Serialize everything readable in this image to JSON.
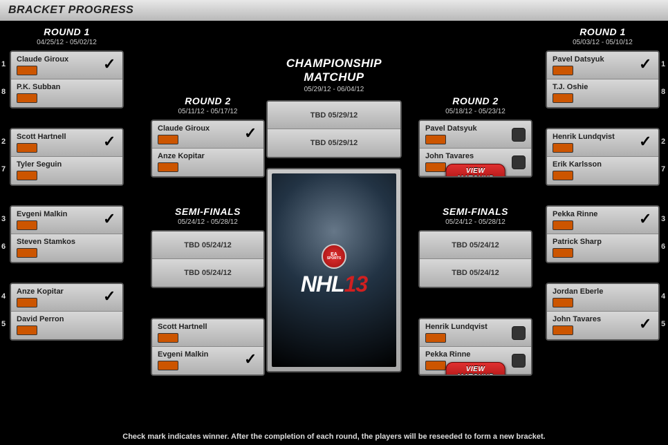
{
  "header": {
    "title": "BRACKET PROGRESS"
  },
  "footer": "Check mark indicates winner. After the completion of each round, the players will be reseeded to form a new bracket.",
  "view_matchup": "VIEW MATCHUP",
  "championship": {
    "title": "CHAMPIONSHIP MATCHUP",
    "dates": "05/29/12 - 06/04/12",
    "slot1": "TBD 05/29/12",
    "slot2": "TBD 05/29/12"
  },
  "game": {
    "brand": "EA",
    "sub": "SPORTS",
    "title_a": "NHL",
    "title_b": "13"
  },
  "left": {
    "r1": {
      "title": "ROUND 1",
      "dates": "04/25/12 - 05/02/12",
      "m": [
        {
          "s1": "1",
          "s2": "8",
          "p1": "Claude Giroux",
          "p2": "P.K. Subban",
          "w": 1,
          "l1": "lg-phi",
          "l2": "lg-mtl"
        },
        {
          "s1": "2",
          "s2": "7",
          "p1": "Scott Hartnell",
          "p2": "Tyler Seguin",
          "w": 1,
          "l1": "lg-phi",
          "l2": "lg-bos"
        },
        {
          "s1": "3",
          "s2": "6",
          "p1": "Evgeni Malkin",
          "p2": "Steven Stamkos",
          "w": 1,
          "l1": "lg-pit",
          "l2": "lg-tb"
        },
        {
          "s1": "4",
          "s2": "5",
          "p1": "Anze Kopitar",
          "p2": "David Perron",
          "w": 1,
          "l1": "lg-la",
          "l2": "lg-stl"
        }
      ]
    },
    "r2": {
      "title": "ROUND 2",
      "dates": "05/11/12 - 05/17/12",
      "m": [
        {
          "p1": "Claude Giroux",
          "p2": "Anze Kopitar",
          "w": 1,
          "l1": "lg-phi",
          "l2": "lg-la"
        },
        {
          "p1": "Scott Hartnell",
          "p2": "Evgeni Malkin",
          "w": 0,
          "l1": "lg-phi",
          "l2": "lg-pit"
        }
      ]
    },
    "sf": {
      "title": "SEMI-FINALS",
      "dates": "05/24/12 - 05/28/12",
      "s1": "TBD 05/24/12",
      "s2": "TBD 05/24/12"
    }
  },
  "right": {
    "r1": {
      "title": "ROUND 1",
      "dates": "05/03/12 - 05/10/12",
      "m": [
        {
          "s1": "1",
          "s2": "8",
          "p1": "Pavel Datsyuk",
          "p2": "T.J. Oshie",
          "w": 1,
          "l1": "lg-det",
          "l2": "lg-stl"
        },
        {
          "s1": "2",
          "s2": "7",
          "p1": "Henrik Lundqvist",
          "p2": "Erik Karlsson",
          "w": 1,
          "l1": "lg-nyr",
          "l2": "lg-ott"
        },
        {
          "s1": "3",
          "s2": "6",
          "p1": "Pekka Rinne",
          "p2": "Patrick Sharp",
          "w": 1,
          "l1": "lg-nsh",
          "l2": "lg-chi"
        },
        {
          "s1": "4",
          "s2": "5",
          "p1": "Jordan Eberle",
          "p2": "John Tavares",
          "w": 2,
          "l1": "lg-edm",
          "l2": "lg-stl"
        }
      ]
    },
    "r2": {
      "title": "ROUND 2",
      "dates": "05/18/12 - 05/23/12",
      "m": [
        {
          "p1": "Pavel Datsyuk",
          "p2": "John Tavares",
          "l1": "lg-det",
          "l2": "lg-stl",
          "box": true
        },
        {
          "p1": "Henrik Lundqvist",
          "p2": "Pekka Rinne",
          "l1": "lg-nyr",
          "l2": "lg-nsh",
          "box": true
        }
      ]
    },
    "sf": {
      "title": "SEMI-FINALS",
      "dates": "05/24/12 - 05/28/12",
      "s1": "TBD 05/24/12",
      "s2": "TBD 05/24/12"
    }
  }
}
